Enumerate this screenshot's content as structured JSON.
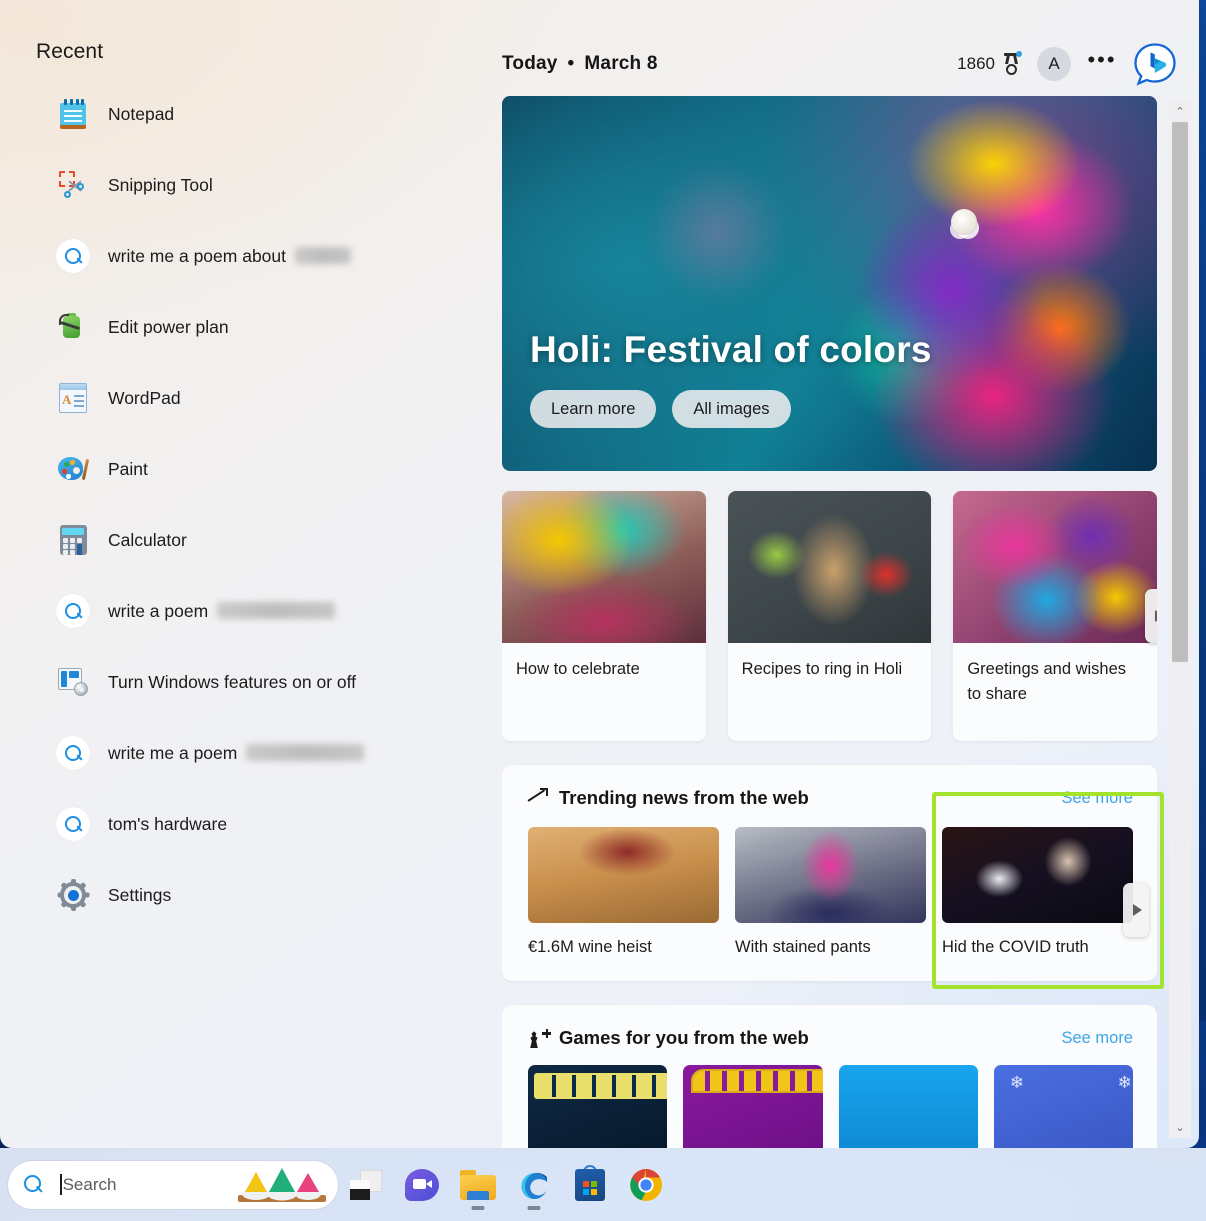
{
  "sidebar": {
    "heading": "Recent",
    "items": [
      {
        "label": "Notepad",
        "icon": "notepad-icon",
        "redacted": 0
      },
      {
        "label": "Snipping Tool",
        "icon": "snipping-tool-icon",
        "redacted": 0
      },
      {
        "label": "write me a poem about",
        "icon": "search-icon",
        "redacted": 56
      },
      {
        "label": "Edit power plan",
        "icon": "power-plan-icon",
        "redacted": 0
      },
      {
        "label": "WordPad",
        "icon": "wordpad-icon",
        "redacted": 0
      },
      {
        "label": "Paint",
        "icon": "paint-icon",
        "redacted": 0
      },
      {
        "label": "Calculator",
        "icon": "calculator-icon",
        "redacted": 0
      },
      {
        "label": "write a poem",
        "icon": "search-icon",
        "redacted": 118
      },
      {
        "label": "Turn Windows features on or off",
        "icon": "windows-features-icon",
        "redacted": 0
      },
      {
        "label": "write me a poem",
        "icon": "search-icon",
        "redacted": 118
      },
      {
        "label": "tom's hardware",
        "icon": "search-icon",
        "redacted": 0
      },
      {
        "label": "Settings",
        "icon": "gear-icon",
        "redacted": 0
      }
    ]
  },
  "header": {
    "today_label": "Today",
    "separator": "•",
    "date": "March 8",
    "points": "1860",
    "points_icon": "medal-icon",
    "avatar_initial": "A",
    "more_label": "•••",
    "bing_icon": "bing-chat-icon"
  },
  "hero": {
    "title": "Holi: Festival of colors",
    "buttons": [
      {
        "label": "Learn more"
      },
      {
        "label": "All images"
      }
    ]
  },
  "trio": {
    "cards": [
      {
        "caption": "How to celebrate"
      },
      {
        "caption": "Recipes to ring in Holi"
      },
      {
        "caption": "Greetings and wishes to share"
      }
    ],
    "next_label": "▶"
  },
  "trending": {
    "title": "Trending news from the web",
    "title_icon": "trending-up-icon",
    "see_more": "See more",
    "items": [
      {
        "caption": "€1.6M wine heist"
      },
      {
        "caption": "With stained pants"
      },
      {
        "caption": "Hid the COVID truth"
      }
    ],
    "next_label": "▶"
  },
  "games": {
    "title": "Games for you from the web",
    "title_icon": "chess-pawn-icon",
    "see_more": "See more",
    "items": [
      {
        "name": "game-thumb-1"
      },
      {
        "name": "game-thumb-2"
      },
      {
        "name": "game-thumb-3"
      },
      {
        "name": "game-thumb-4"
      }
    ]
  },
  "scrollbar": {
    "up_label": "⌃",
    "down_label": "⌄"
  },
  "highlight": {
    "color": "#a4e32c"
  },
  "taskbar": {
    "search_placeholder": "Search",
    "search_value": "",
    "doodle_icon": "holi-colors-doodle-icon",
    "icons": [
      {
        "name": "task-view-icon",
        "active": false
      },
      {
        "name": "chat-icon",
        "active": false
      },
      {
        "name": "file-explorer-icon",
        "active": true
      },
      {
        "name": "edge-icon",
        "active": true
      },
      {
        "name": "microsoft-store-icon",
        "active": false
      },
      {
        "name": "chrome-icon",
        "active": false
      }
    ]
  }
}
